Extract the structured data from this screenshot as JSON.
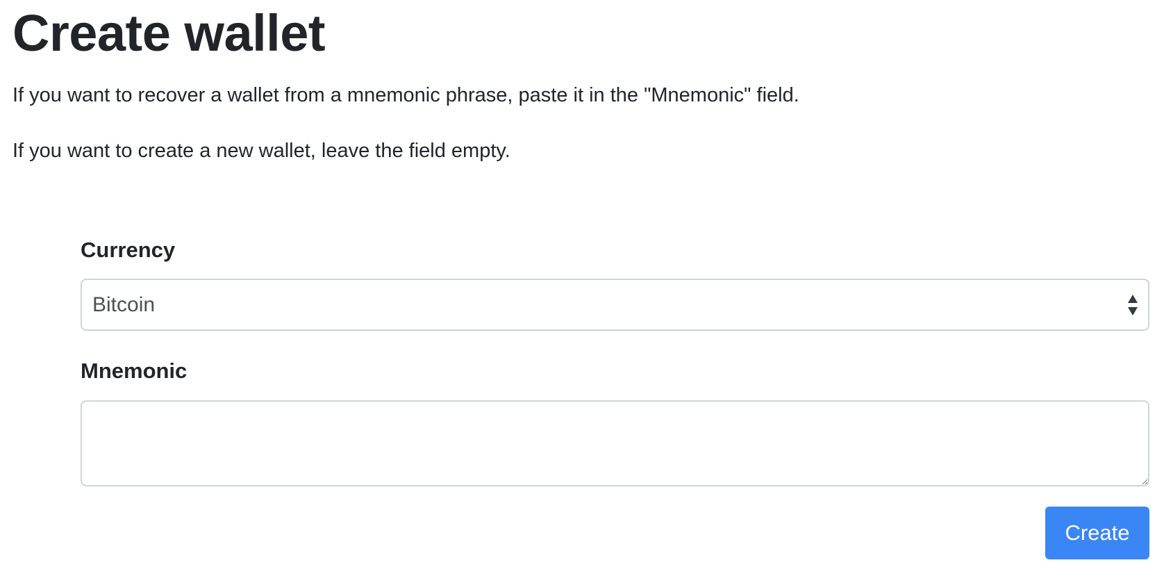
{
  "page": {
    "title": "Create wallet",
    "intro_recover": "If you want to recover a wallet from a mnemonic phrase, paste it in the \"Mnemonic\" field.",
    "intro_new": "If you want to create a new wallet, leave the field empty."
  },
  "form": {
    "currency": {
      "label": "Currency",
      "selected": "Bitcoin",
      "icon": "select-up-down-arrows-icon"
    },
    "mnemonic": {
      "label": "Mnemonic",
      "value": "",
      "placeholder": ""
    },
    "submit_label": "Create"
  },
  "colors": {
    "text": "#212529",
    "input_text": "#495057",
    "input_border": "#ced4da",
    "primary_button": "#3b86f5",
    "button_text": "#ffffff"
  }
}
